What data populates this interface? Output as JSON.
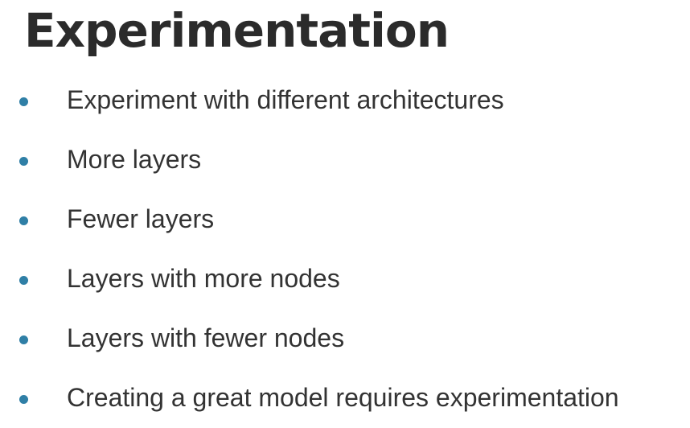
{
  "title": "Experimentation",
  "accent_color": "#2f7fa6",
  "bullets": [
    "Experiment with different architectures",
    "More layers",
    "Fewer layers",
    "Layers with more nodes",
    "Layers with fewer nodes",
    "Creating a great model requires experimentation"
  ]
}
